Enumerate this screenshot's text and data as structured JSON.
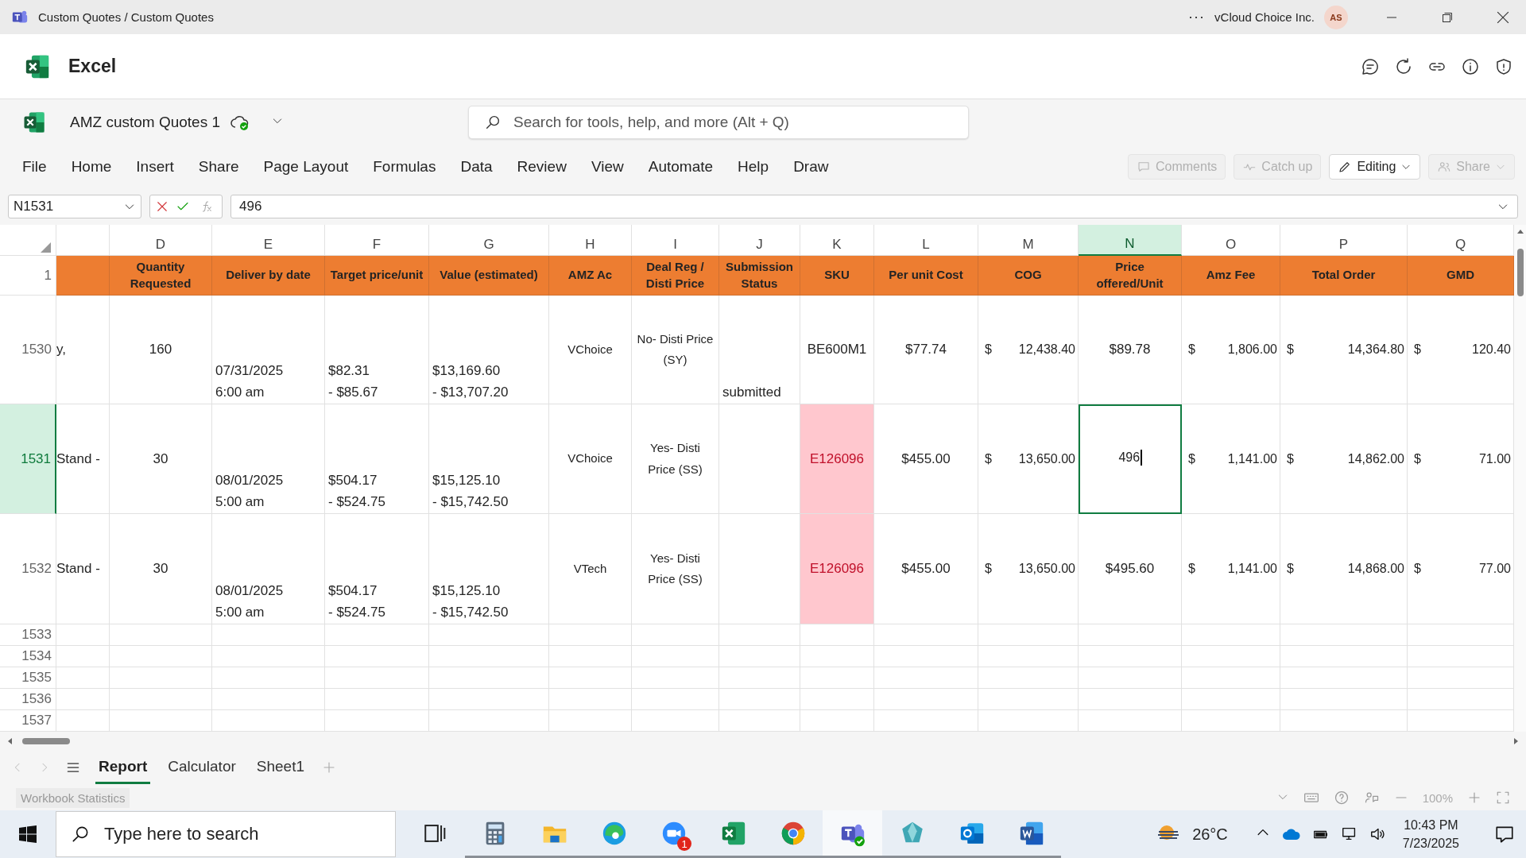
{
  "window": {
    "title": "Custom Quotes / Custom Quotes",
    "more": "···",
    "org": "vCloud Choice Inc.",
    "avatar": "AS"
  },
  "app_header": {
    "title": "Excel"
  },
  "file_bar": {
    "name": "AMZ custom Quotes 1",
    "search": {
      "placeholder": "Search for tools, help, and more (Alt + Q)"
    }
  },
  "menu": [
    "File",
    "Home",
    "Insert",
    "Share",
    "Page Layout",
    "Formulas",
    "Data",
    "Review",
    "View",
    "Automate",
    "Help",
    "Draw"
  ],
  "actions": [
    {
      "kind": "comments",
      "label": "Comments",
      "disabled": true,
      "dropdown": false
    },
    {
      "kind": "catch-up",
      "label": "Catch up",
      "disabled": true,
      "dropdown": false
    },
    {
      "kind": "editing",
      "label": "Editing",
      "disabled": false,
      "dropdown": true
    },
    {
      "kind": "share",
      "label": "Share",
      "disabled": true,
      "dropdown": true
    }
  ],
  "formula_bar": {
    "name_box": "N1531",
    "value": "496"
  },
  "columns": [
    {
      "selected": false
    },
    {
      "label": "D",
      "selected": false
    },
    {
      "label": "E",
      "selected": false
    },
    {
      "label": "F",
      "selected": false
    },
    {
      "label": "G",
      "selected": false
    },
    {
      "label": "H",
      "selected": false
    },
    {
      "label": "I",
      "selected": false
    },
    {
      "label": "J",
      "selected": false
    },
    {
      "label": "K",
      "selected": false
    },
    {
      "label": "L",
      "selected": false
    },
    {
      "label": "M",
      "selected": false
    },
    {
      "label": "N",
      "selected": true
    },
    {
      "label": "O",
      "selected": false
    },
    {
      "label": "P",
      "selected": false
    },
    {
      "label": "Q",
      "selected": false
    }
  ],
  "header_row": {
    "number": "1",
    "cells": [
      "Quantity\nRequested",
      "Deliver by date",
      "Target price/unit",
      "Value (estimated)",
      "AMZ Ac",
      "Deal Reg /\nDisti Price",
      "Submission\nStatus",
      "SKU",
      "Per unit Cost",
      "COG",
      "Price\noffered/Unit",
      "Amz Fee",
      "Total Order",
      "GMD"
    ]
  },
  "rows": [
    {
      "number": "1530",
      "selected": false,
      "cells": [
        {
          "kind": "left",
          "value": "y,"
        },
        {
          "kind": "center",
          "value": "160"
        },
        {
          "kind": "bottom",
          "value": "07/31/2025\n6:00 am"
        },
        {
          "kind": "bottom",
          "value": "$82.31\n- $85.67"
        },
        {
          "kind": "bottom",
          "value": "$13,169.60\n- $13,707.20"
        },
        {
          "kind": "label",
          "value": "VChoice"
        },
        {
          "kind": "label",
          "value": "No- Disti Price\n(SY)"
        },
        {
          "kind": "bottom",
          "value": "submitted"
        },
        {
          "kind": "center",
          "value": "BE600M1"
        },
        {
          "kind": "center",
          "value": "$77.74"
        },
        {
          "kind": "accounting",
          "symbol": "$",
          "value": "12,438.40"
        },
        {
          "kind": "center",
          "value": "$89.78"
        },
        {
          "kind": "accounting",
          "symbol": "$",
          "value": "1,806.00"
        },
        {
          "kind": "accounting",
          "symbol": "$",
          "value": "14,364.80"
        },
        {
          "kind": "accounting",
          "symbol": "$",
          "value": "120.40"
        }
      ]
    },
    {
      "number": "1531",
      "selected": true,
      "cells": [
        {
          "kind": "left",
          "value": "Stand -"
        },
        {
          "kind": "center",
          "value": "30"
        },
        {
          "kind": "bottom",
          "value": "08/01/2025\n5:00 am"
        },
        {
          "kind": "bottom",
          "value": "$504.17\n- $524.75"
        },
        {
          "kind": "bottom",
          "value": "$15,125.10\n- $15,742.50"
        },
        {
          "kind": "label",
          "value": "VChoice"
        },
        {
          "kind": "label",
          "value": "Yes- Disti\nPrice (SS)"
        },
        {
          "kind": "empty"
        },
        {
          "kind": "flagged",
          "value": "E126096"
        },
        {
          "kind": "center",
          "value": "$455.00"
        },
        {
          "kind": "accounting",
          "symbol": "$",
          "value": "13,650.00"
        },
        {
          "kind": "editing",
          "value": "496"
        },
        {
          "kind": "accounting",
          "symbol": "$",
          "value": "1,141.00"
        },
        {
          "kind": "accounting",
          "symbol": "$",
          "value": "14,862.00"
        },
        {
          "kind": "accounting",
          "symbol": "$",
          "value": "71.00"
        }
      ]
    },
    {
      "number": "1532",
      "selected": false,
      "cells": [
        {
          "kind": "left",
          "value": "Stand -"
        },
        {
          "kind": "center",
          "value": "30"
        },
        {
          "kind": "bottom",
          "value": "08/01/2025\n5:00 am"
        },
        {
          "kind": "bottom",
          "value": "$504.17\n- $524.75"
        },
        {
          "kind": "bottom",
          "value": "$15,125.10\n- $15,742.50"
        },
        {
          "kind": "label",
          "value": "VTech"
        },
        {
          "kind": "label",
          "value": "Yes- Disti\nPrice (SS)"
        },
        {
          "kind": "empty"
        },
        {
          "kind": "flagged",
          "value": "E126096"
        },
        {
          "kind": "center",
          "value": "$455.00"
        },
        {
          "kind": "accounting",
          "symbol": "$",
          "value": "13,650.00"
        },
        {
          "kind": "center",
          "value": "$495.60"
        },
        {
          "kind": "accounting",
          "symbol": "$",
          "value": "1,141.00"
        },
        {
          "kind": "accounting",
          "symbol": "$",
          "value": "14,868.00"
        },
        {
          "kind": "accounting",
          "symbol": "$",
          "value": "77.00"
        }
      ]
    },
    {
      "number": "1533",
      "selected": false
    },
    {
      "number": "1534",
      "selected": false
    },
    {
      "number": "1535",
      "selected": false
    },
    {
      "number": "1536",
      "selected": false
    },
    {
      "number": "1537",
      "selected": false
    }
  ],
  "sheet_tabs": [
    {
      "label": "Report",
      "selected": true
    },
    {
      "label": "Calculator",
      "selected": false
    },
    {
      "label": "Sheet1",
      "selected": false
    }
  ],
  "status_bar": {
    "button": "Workbook Statistics",
    "zoom": "100%"
  },
  "taskbar": {
    "search": {
      "placeholder": "Type here to search"
    },
    "apps": [
      {
        "kind": "task-view",
        "running": false,
        "selected": false
      },
      {
        "kind": "calculator",
        "running": true,
        "selected": false
      },
      {
        "kind": "folder",
        "running": true,
        "selected": false
      },
      {
        "kind": "edge",
        "running": true,
        "selected": false
      },
      {
        "kind": "zoom",
        "running": true,
        "selected": false,
        "badge": "1"
      },
      {
        "kind": "excel",
        "running": true,
        "selected": false
      },
      {
        "kind": "chrome",
        "running": true,
        "selected": false
      },
      {
        "kind": "teams",
        "running": true,
        "selected": true
      },
      {
        "kind": "gem",
        "running": true,
        "selected": false
      },
      {
        "kind": "outlook",
        "running": true,
        "selected": false
      },
      {
        "kind": "word",
        "running": true,
        "selected": false
      }
    ],
    "weather": "26°C",
    "time": "10:43 PM",
    "date": "7/23/2025"
  }
}
